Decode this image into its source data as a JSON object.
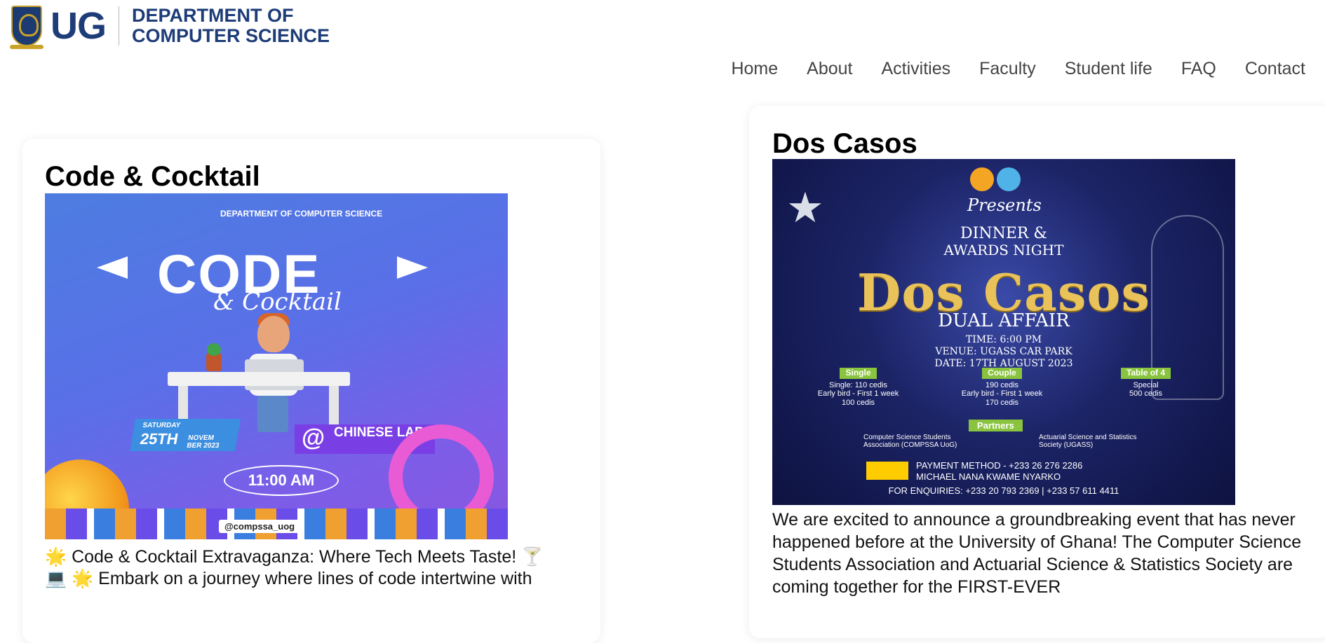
{
  "header": {
    "logo_text": "UG",
    "dept_line1": "DEPARTMENT OF",
    "dept_line2": "COMPUTER SCIENCE"
  },
  "nav": {
    "items": [
      {
        "label": "Home"
      },
      {
        "label": "About"
      },
      {
        "label": "Activities"
      },
      {
        "label": "Faculty"
      },
      {
        "label": "Student life"
      },
      {
        "label": "FAQ"
      },
      {
        "label": "Contact"
      }
    ]
  },
  "events": [
    {
      "title": "Code & Cocktail",
      "poster": {
        "dept": "DEPARTMENT OF COMPUTER SCIENCE",
        "main_title": "CODE",
        "subtitle": "& Cocktail",
        "day": "SATURDAY",
        "date": "25TH",
        "date_month": "NOVEM BER 2023",
        "venue": "CHINESE LAB",
        "time": "11:00 AM",
        "handle": "@compssa_uog"
      },
      "description_line1": "🌟 Code & Cocktail Extravaganza: Where Tech Meets Taste! 🍸",
      "description_line2": "💻 🌟 Embark on a journey where lines of code intertwine with"
    },
    {
      "title": "Dos Casos",
      "poster": {
        "presents": "Presents",
        "line1": "DINNER &",
        "line2": "AWARDS NIGHT",
        "big": "Dos Casos",
        "subtitle": "DUAL AFFAIR",
        "time": "TIME: 6:00 PM",
        "venue": "VENUE: UGASS CAR PARK",
        "date": "DATE: 17TH AUGUST 2023",
        "tiers": [
          {
            "tag": "Single",
            "l1": "Single: 110 cedis",
            "l2": "Early bird - First 1 week",
            "l3": "100 cedis"
          },
          {
            "tag": "Couple",
            "l1": "190 cedis",
            "l2": "Early bird - First 1 week",
            "l3": "170 cedis"
          },
          {
            "tag": "Table of 4",
            "l1": "Special",
            "l2": "500 cedis",
            "l3": ""
          }
        ],
        "partners_tag": "Partners",
        "partner1": "Computer Science Students Association (COMPSSA UoG)",
        "partner2": "Actuarial Science and Statistics Society (UGASS)",
        "payment": "PAYMENT METHOD - +233 26 276 2286",
        "payment_name": "MICHAEL NANA KWAME NYARKO",
        "enquiries": "FOR ENQUIRIES: +233 20 793 2369 | +233 57 611 4411"
      },
      "description": "We are excited to announce a groundbreaking event that has never happened before at the University of Ghana! The Computer Science Students Association and Actuarial Science & Statistics Society are coming together for the FIRST-EVER"
    }
  ],
  "colors": {
    "brand_blue": "#1d3c78",
    "nav_text": "#444444"
  }
}
